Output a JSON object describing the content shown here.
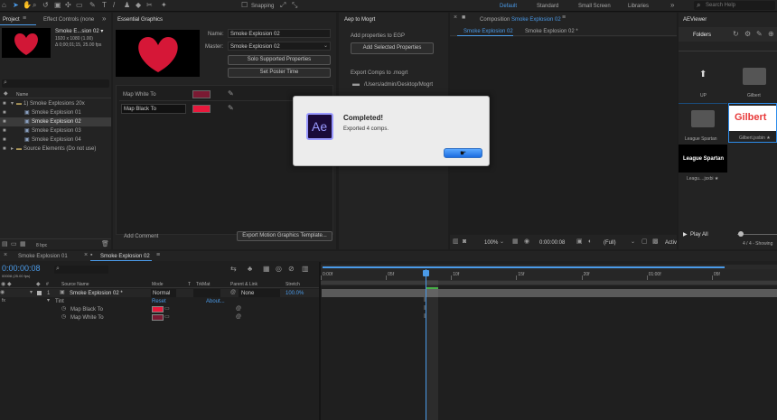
{
  "toolbar": {
    "snapping": "Snapping",
    "workspaces": [
      "Default",
      "Standard",
      "Small Screen",
      "Libraries"
    ],
    "search_placeholder": "Search Help"
  },
  "project": {
    "tab_project": "Project",
    "tab_effect_controls": "Effect Controls (none",
    "item_name": "Smoke E...sion 02 ▾",
    "item_size": "1920 x 1080 (1.00)",
    "item_time": "Δ 0;00;01;15, 25.00 fps",
    "col_name": "Name",
    "items": [
      {
        "label": "1) Smoke Explosions 20x",
        "indent": 0,
        "kind": "folder"
      },
      {
        "label": "Smoke Explosion 01",
        "indent": 1,
        "kind": "comp"
      },
      {
        "label": "Smoke Explosion 02",
        "indent": 1,
        "kind": "comp",
        "selected": true
      },
      {
        "label": "Smoke Explosion 03",
        "indent": 1,
        "kind": "comp"
      },
      {
        "label": "Smoke Explosion 04",
        "indent": 1,
        "kind": "comp"
      },
      {
        "label": "Source Elements (Do not use)",
        "indent": 0,
        "kind": "folder"
      }
    ],
    "bpc": "8 bpc"
  },
  "essential_graphics": {
    "title": "Essential Graphics",
    "name_label": "Name:",
    "name_value": "Smoke Explosion 02",
    "master_label": "Master:",
    "master_value": "Smoke Explosion 02",
    "solo_button": "Solo Supported Properties",
    "poster_button": "Set Poster Time",
    "props": [
      {
        "label": "Map White To",
        "color": "#7a1a33"
      },
      {
        "label": "Map Black To",
        "color": "#e8193c"
      }
    ],
    "add_comment": "Add Comment",
    "export_button": "Export Motion Graphics Template..."
  },
  "aep": {
    "title": "Aep to Mogrt",
    "add_props_label": "Add properties to EGP",
    "add_selected_button": "Add Selected Properties",
    "export_label": "Export Comps to .mogrt",
    "path": "/Users/admin/Desktop/Mogrt"
  },
  "composition": {
    "title_prefix": "Composition",
    "title_name": "Smoke Explosion 02",
    "tabs": [
      "Smoke Explosion 02",
      "Smoke Explosion 02 *"
    ],
    "zoom": "100%",
    "timecode": "0:00:00:08",
    "resolution": "(Full)",
    "active": "Activ"
  },
  "aeviewer": {
    "title": "AEViewer",
    "folders_button": "Folders",
    "items": [
      {
        "label": "UP",
        "kind": "up"
      },
      {
        "label": "Gilbert",
        "kind": "folder"
      },
      {
        "label": "League Spartan",
        "kind": "folder"
      },
      {
        "label": "Gilbert.jsxbin ★",
        "kind": "gilbert"
      },
      {
        "label": "Leagu....jsxbi ★",
        "kind": "league"
      }
    ],
    "league_text": "League Spartan",
    "gilbert_text": "Gilbert",
    "play_all": "Play All",
    "showing": "4 / 4 - Showing"
  },
  "timeline": {
    "tabs": [
      "Smoke Explosion 01",
      "Smoke Explosion 02"
    ],
    "timecode": "0:00:00:08",
    "timecode_sub": "00008 (25.00 fps)",
    "headers": {
      "source": "Source Name",
      "mode": "Mode",
      "t": "T",
      "trkmat": "TrkMat",
      "parent": "Parent & Link",
      "stretch": "Stretch"
    },
    "layer": {
      "num": "1",
      "name": "Smoke Explosion 02 *",
      "mode": "Normal",
      "parent": "None",
      "stretch": "100.0%"
    },
    "effect": "Tint",
    "effect_reset": "Reset",
    "effect_about": "About...",
    "params": [
      {
        "label": "Map Black To",
        "color": "#e8193c"
      },
      {
        "label": "Map White To",
        "color": "#7a1a33"
      }
    ],
    "ruler": [
      "0:00f",
      "05f",
      "10f",
      "15f",
      "20f",
      "01:00f",
      "05f"
    ]
  },
  "dialog": {
    "app_icon": "Ae",
    "title": "Completed!",
    "message": "Exported 4 comps."
  },
  "colors": {
    "accent": "#2d8ceb",
    "heart": "#e8193c"
  }
}
